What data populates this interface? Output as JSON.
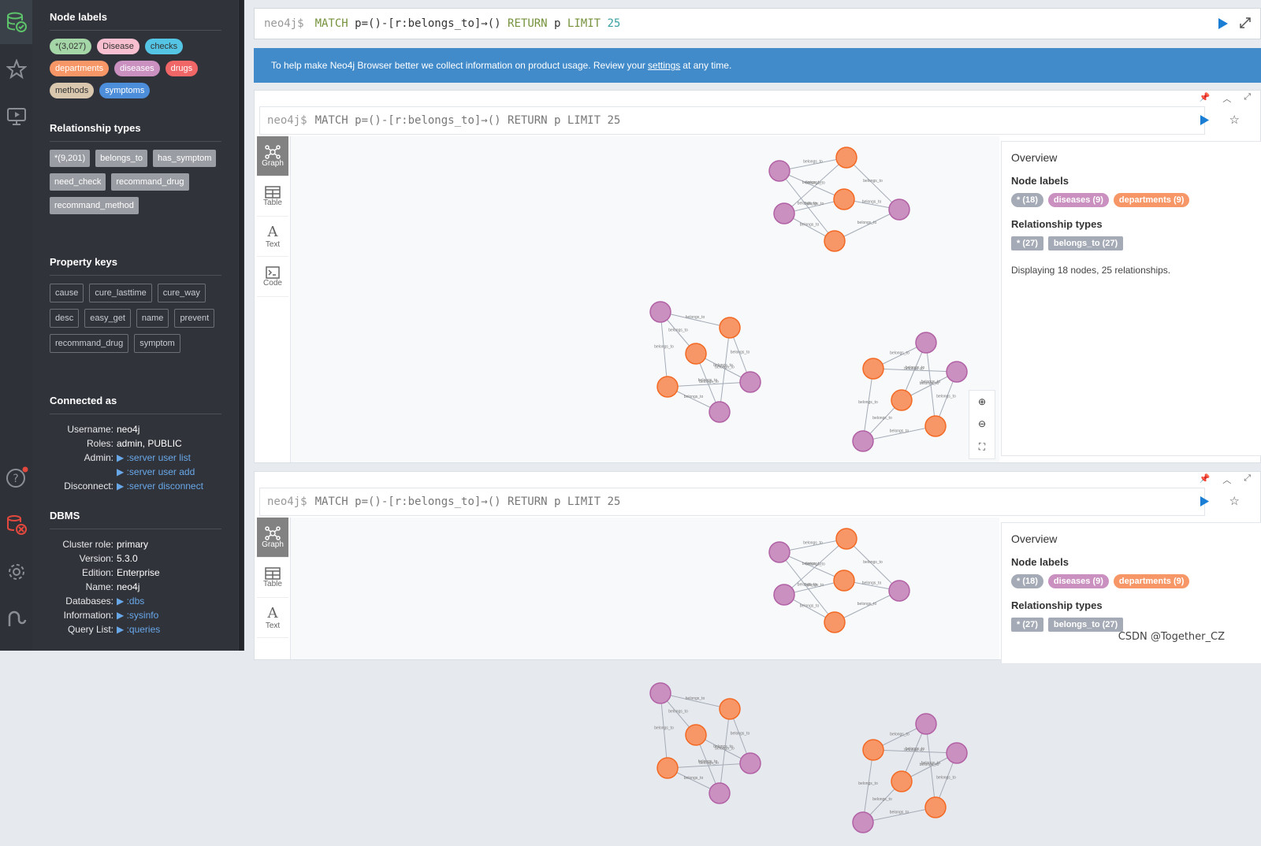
{
  "sidebar": {
    "node_labels_title": "Node labels",
    "node_labels": [
      {
        "label": "*(3,027)",
        "color": "#a5d6a7",
        "text": "#333"
      },
      {
        "label": "Disease",
        "color": "#f7bfd0",
        "text": "#333"
      },
      {
        "label": "checks",
        "color": "#54c5e4",
        "text": "#333"
      },
      {
        "label": "departments",
        "color": "#f79767",
        "text": "#fff"
      },
      {
        "label": "diseases",
        "color": "#c990c0",
        "text": "#fff"
      },
      {
        "label": "drugs",
        "color": "#f16667",
        "text": "#fff"
      },
      {
        "label": "methods",
        "color": "#d9c8ae",
        "text": "#333"
      },
      {
        "label": "symptoms",
        "color": "#4c8eda",
        "text": "#fff"
      }
    ],
    "rel_types_title": "Relationship types",
    "rel_types": [
      "*(9,201)",
      "belongs_to",
      "has_symptom",
      "need_check",
      "recommand_drug",
      "recommand_method"
    ],
    "property_keys_title": "Property keys",
    "property_keys": [
      "cause",
      "cure_lasttime",
      "cure_way",
      "desc",
      "easy_get",
      "name",
      "prevent",
      "recommand_drug",
      "symptom"
    ],
    "connected_title": "Connected as",
    "connected": {
      "username_k": "Username:",
      "username_v": "neo4j",
      "roles_k": "Roles:",
      "roles_v": "admin, PUBLIC",
      "admin_k": "Admin:",
      "admin_v1": ":server user list",
      "admin_v2": ":server user add",
      "disconnect_k": "Disconnect:",
      "disconnect_v": ":server disconnect"
    },
    "dbms_title": "DBMS",
    "dbms": {
      "cluster_k": "Cluster role:",
      "cluster_v": "primary",
      "version_k": "Version:",
      "version_v": "5.3.0",
      "edition_k": "Edition:",
      "edition_v": "Enterprise",
      "name_k": "Name:",
      "name_v": "neo4j",
      "databases_k": "Databases:",
      "databases_v": ":dbs",
      "information_k": "Information:",
      "information_v": ":sysinfo",
      "querylist_k": "Query List:",
      "querylist_v": ":queries"
    }
  },
  "editor": {
    "prompt": "neo4j$",
    "q1": "MATCH",
    "q2": " p=()-[r:belongs_to]→() ",
    "q3": "RETURN",
    "q4": " p ",
    "q5": "LIMIT",
    "q6": " 25"
  },
  "banner": {
    "text_before": "To help make Neo4j Browser better we collect information on product usage. Review your",
    "link": "settings",
    "text_after": "at any time."
  },
  "frame": {
    "prompt": "neo4j$",
    "query": "MATCH p=()-[r:belongs_to]→() RETURN p LIMIT 25",
    "tabs": {
      "graph": "Graph",
      "table": "Table",
      "text": "Text",
      "code": "Code"
    },
    "overview": {
      "title": "Overview",
      "node_labels_title": "Node labels",
      "node_pills": [
        {
          "label": "* (18)",
          "color": "#a5abb6"
        },
        {
          "label": "diseases (9)",
          "color": "#c990c0"
        },
        {
          "label": "departments (9)",
          "color": "#f79767"
        }
      ],
      "rel_title": "Relationship types",
      "rel_pills": [
        "* (27)",
        "belongs_to (27)"
      ],
      "summary": "Displaying 18 nodes, 25 relationships."
    },
    "graph": {
      "disease_color": "#c990c0",
      "dept_color": "#f79767",
      "rel_label": "belongs_to"
    }
  },
  "watermark": "CSDN @Together_CZ"
}
